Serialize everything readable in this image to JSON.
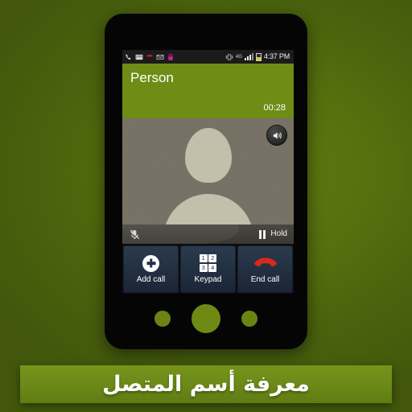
{
  "background": {
    "color_outer": "#42570c",
    "color_inner": "#5f7a10"
  },
  "phone": {
    "body_color": "#050505",
    "hardware_buttons": [
      {
        "name": "menu-button"
      },
      {
        "name": "home-button"
      },
      {
        "name": "back-button"
      }
    ]
  },
  "statusbar": {
    "left_icons": [
      {
        "icon": "phone-call-icon"
      },
      {
        "icon": "screenshot-image-icon"
      },
      {
        "icon": "missed-call-icon"
      },
      {
        "icon": "email-envelope-icon"
      },
      {
        "icon": "lock-icon"
      }
    ],
    "right_icons": [
      {
        "icon": "vibrate-mute-icon"
      },
      {
        "icon": "network-4g-icon"
      },
      {
        "icon": "signal-bars-icon"
      },
      {
        "icon": "battery-icon"
      }
    ],
    "network_label": "4G",
    "time": "4:37 PM",
    "background": "#1b1b1b"
  },
  "call_screen": {
    "header_color": "#6f8c15",
    "caller_name": "Person",
    "call_duration": "00:28",
    "photo": {
      "avatar_name": "default-contact-avatar",
      "avatar_color": "#c3bfab",
      "background": "#756f63"
    },
    "speaker_button": {
      "label": "speaker-icon",
      "active": false
    },
    "control_bar": {
      "mute": {
        "icon": "microphone-muted-icon",
        "label": ""
      },
      "hold": {
        "icon": "pause-icon",
        "label": "Hold"
      }
    },
    "actions": [
      {
        "name": "add-call",
        "icon": "plus-circle-icon",
        "label": "Add call"
      },
      {
        "name": "keypad",
        "icon": "keypad-grid-icon",
        "label": "Keypad",
        "keys": [
          "1",
          "2",
          "3",
          "4"
        ]
      },
      {
        "name": "end-call",
        "icon": "end-call-handset-icon",
        "label": "End call",
        "icon_color": "#d8291c"
      }
    ]
  },
  "banner": {
    "text": "معرفة أسم المتصل",
    "background": "#6c8a18",
    "text_color": "#ffffff"
  }
}
